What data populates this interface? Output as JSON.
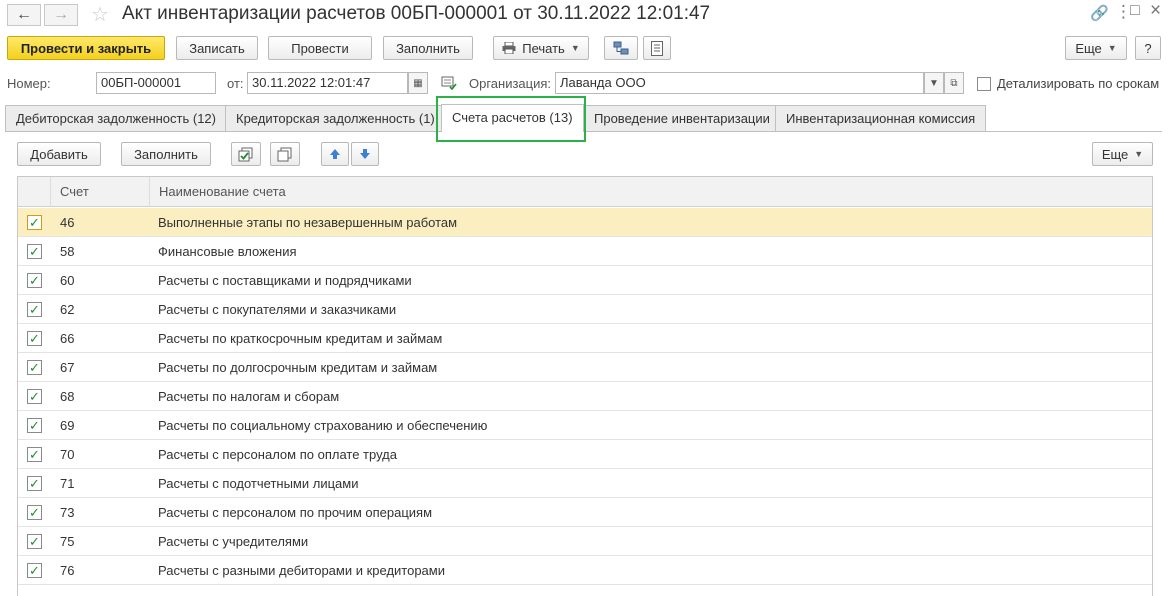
{
  "window": {
    "title": "Акт инвентаризации расчетов 00БП-000001 от 30.11.2022 12:01:47",
    "back_icon": "←",
    "forward_icon": "→",
    "star_icon": "☆",
    "link_icon": "🔗",
    "menu_icon": "⋮",
    "maximize_icon": "□",
    "close_icon": "×"
  },
  "toolbar": {
    "post_close_label": "Провести и закрыть",
    "save_label": "Записать",
    "post_label": "Провести",
    "fill_label": "Заполнить",
    "print_label": "Печать",
    "more_label": "Еще",
    "help_label": "?"
  },
  "header": {
    "number_label": "Номер:",
    "number_value": "00БП-000001",
    "date_label": "от:",
    "date_value": "30.11.2022 12:01:47",
    "org_label": "Организация:",
    "org_value": "Лаванда ООО",
    "detail_label": "Детализировать по срокам"
  },
  "tabs": [
    {
      "label": "Дебиторская задолженность (12)"
    },
    {
      "label": "Кредиторская задолженность (1)"
    },
    {
      "label": "Счета расчетов (13)"
    },
    {
      "label": "Проведение инвентаризации"
    },
    {
      "label": "Инвентаризационная комиссия"
    }
  ],
  "tab_toolbar": {
    "add_label": "Добавить",
    "fill_label": "Заполнить",
    "more_label": "Еще"
  },
  "table": {
    "columns": [
      "Счет",
      "Наименование счета"
    ],
    "rows": [
      {
        "account": "46",
        "name": "Выполненные этапы по незавершенным работам",
        "checked": true
      },
      {
        "account": "58",
        "name": "Финансовые вложения",
        "checked": true
      },
      {
        "account": "60",
        "name": "Расчеты с поставщиками и подрядчиками",
        "checked": true
      },
      {
        "account": "62",
        "name": "Расчеты с покупателями и заказчиками",
        "checked": true
      },
      {
        "account": "66",
        "name": "Расчеты по краткосрочным кредитам и займам",
        "checked": true
      },
      {
        "account": "67",
        "name": "Расчеты по долгосрочным кредитам и займам",
        "checked": true
      },
      {
        "account": "68",
        "name": "Расчеты по налогам и сборам",
        "checked": true
      },
      {
        "account": "69",
        "name": "Расчеты по социальному страхованию и обеспечению",
        "checked": true
      },
      {
        "account": "70",
        "name": "Расчеты с персоналом по оплате труда",
        "checked": true
      },
      {
        "account": "71",
        "name": "Расчеты с подотчетными лицами",
        "checked": true
      },
      {
        "account": "73",
        "name": "Расчеты с персоналом по прочим операциям",
        "checked": true
      },
      {
        "account": "75",
        "name": "Расчеты с учредителями",
        "checked": true
      },
      {
        "account": "76",
        "name": "Расчеты с разными дебиторами и кредиторами",
        "checked": true
      }
    ]
  },
  "colors": {
    "primary_button": "#f3d11e",
    "selected_row": "#fbeec1",
    "highlight_border": "#2bb04a",
    "checkmark": "#1e8f2e"
  }
}
